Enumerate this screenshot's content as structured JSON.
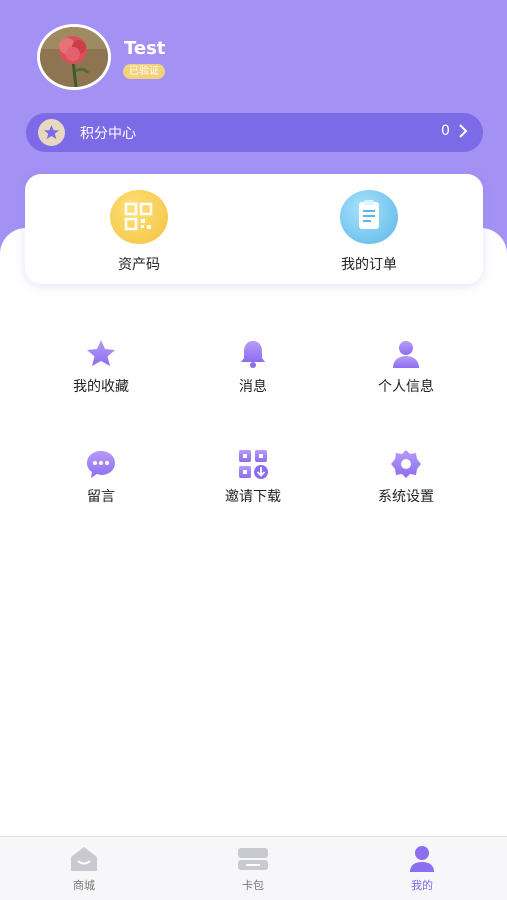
{
  "colors": {
    "header_background": "#a392f4",
    "points_bar": "#7d6ae6",
    "accent_purple": "#8c6ef0",
    "verified_badge": "#f3d27c",
    "asset_code_icon": "#f2c23f",
    "order_icon": "#5ab6e8"
  },
  "profile": {
    "avatar_icon": "rose-photo",
    "name": "Test",
    "verified_badge": "已验证"
  },
  "points": {
    "icon": "star-icon",
    "label": "积分中心",
    "value": "0"
  },
  "quick_actions": [
    {
      "icon": "qr-code-icon",
      "label": "资产码"
    },
    {
      "icon": "order-list-icon",
      "label": "我的订单"
    }
  ],
  "menu": [
    {
      "icon": "star-icon",
      "label": "我的收藏"
    },
    {
      "icon": "bell-icon",
      "label": "消息"
    },
    {
      "icon": "person-icon",
      "label": "个人信息"
    },
    {
      "icon": "chat-bubble-icon",
      "label": "留言"
    },
    {
      "icon": "download-qr-icon",
      "label": "邀请下载"
    },
    {
      "icon": "gear-icon",
      "label": "系统设置"
    }
  ],
  "tabbar": [
    {
      "icon": "shop-icon",
      "label": "商城",
      "active": false
    },
    {
      "icon": "card-icon",
      "label": "卡包",
      "active": false
    },
    {
      "icon": "person-icon",
      "label": "我的",
      "active": true
    }
  ]
}
